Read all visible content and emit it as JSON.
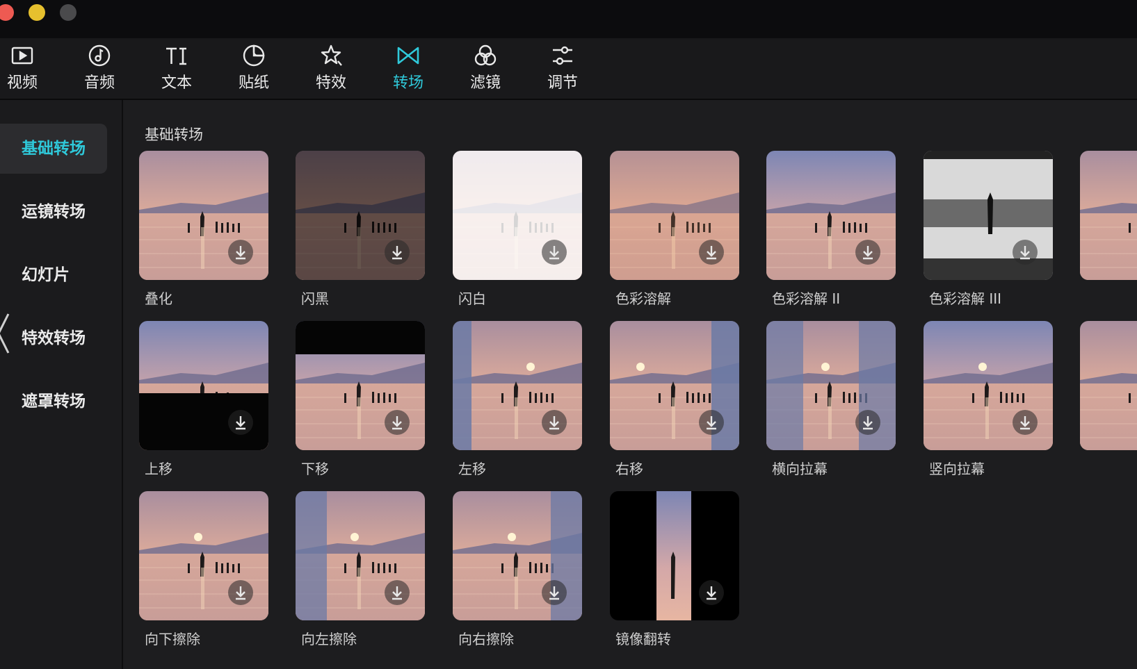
{
  "window": {
    "traffic_lights": [
      {
        "name": "close",
        "color": "#ee5a52"
      },
      {
        "name": "minimize",
        "color": "#e6c02e"
      },
      {
        "name": "zoom",
        "color": "#4a4a4c"
      }
    ]
  },
  "toolbar": {
    "accent_color": "#2fc9da",
    "items": [
      {
        "id": "video",
        "label": "视频",
        "icon": "video-icon"
      },
      {
        "id": "audio",
        "label": "音频",
        "icon": "audio-icon"
      },
      {
        "id": "text",
        "label": "文本",
        "icon": "text-icon"
      },
      {
        "id": "sticker",
        "label": "贴纸",
        "icon": "sticker-icon"
      },
      {
        "id": "effects",
        "label": "特效",
        "icon": "effects-icon"
      },
      {
        "id": "transition",
        "label": "转场",
        "icon": "transition-icon",
        "active": true
      },
      {
        "id": "filter",
        "label": "滤镜",
        "icon": "filter-icon"
      },
      {
        "id": "adjust",
        "label": "调节",
        "icon": "adjust-icon"
      }
    ]
  },
  "sidebar": {
    "items": [
      {
        "label": "基础转场",
        "active": true
      },
      {
        "label": "运镜转场"
      },
      {
        "label": "幻灯片"
      },
      {
        "label": "特效转场"
      },
      {
        "label": "遮罩转场"
      }
    ]
  },
  "main": {
    "section_title": "基础转场",
    "transitions": [
      {
        "label": "叠化"
      },
      {
        "label": "闪黑"
      },
      {
        "label": "闪白"
      },
      {
        "label": "色彩溶解"
      },
      {
        "label": "色彩溶解 II"
      },
      {
        "label": "色彩溶解 III"
      },
      {
        "label": "上移"
      },
      {
        "label": "下移"
      },
      {
        "label": "左移"
      },
      {
        "label": "右移"
      },
      {
        "label": "横向拉幕"
      },
      {
        "label": "竖向拉幕"
      },
      {
        "label": "向下擦除"
      },
      {
        "label": "向左擦除"
      },
      {
        "label": "向右擦除"
      },
      {
        "label": "镜像翻转"
      }
    ]
  }
}
